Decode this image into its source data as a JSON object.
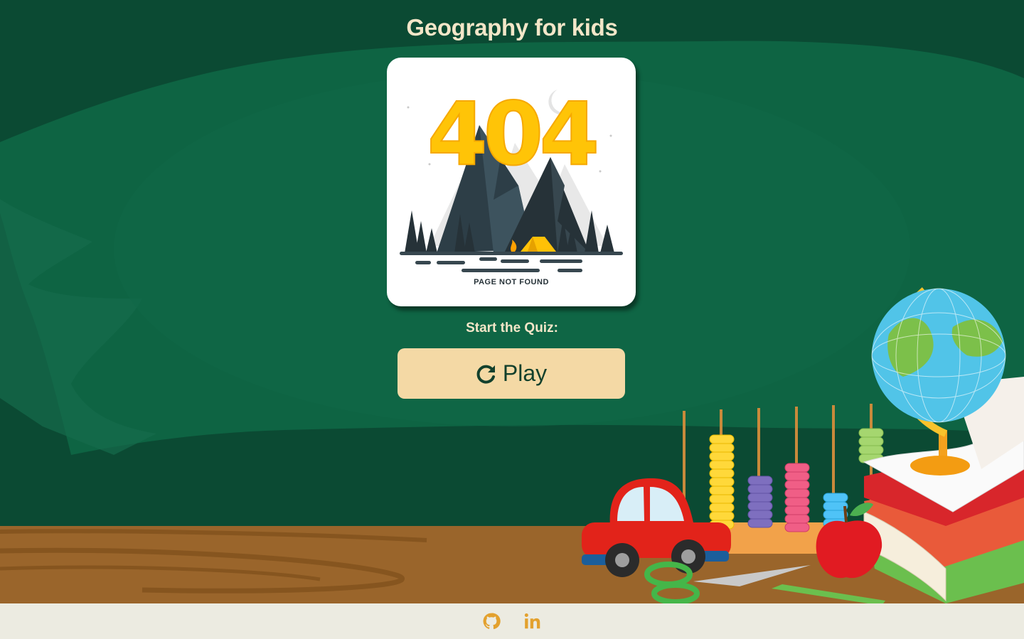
{
  "header": {
    "title": "Geography for kids"
  },
  "hero": {
    "image_number": "404",
    "image_caption": "PAGE NOT FOUND"
  },
  "quiz": {
    "prompt": "Start the Quiz:",
    "play_label": "Play",
    "play_icon": "redo-icon"
  },
  "footer": {
    "links": [
      {
        "icon": "github-icon"
      },
      {
        "icon": "linkedin-icon"
      }
    ]
  },
  "colors": {
    "background": "#0d5c3f",
    "title": "#f3e6c8",
    "button_bg": "#f4d9a5",
    "button_text": "#12402c",
    "footer_bg": "#ecebe1",
    "footer_icons": "#e3a12e",
    "desk": "#9a652b"
  }
}
